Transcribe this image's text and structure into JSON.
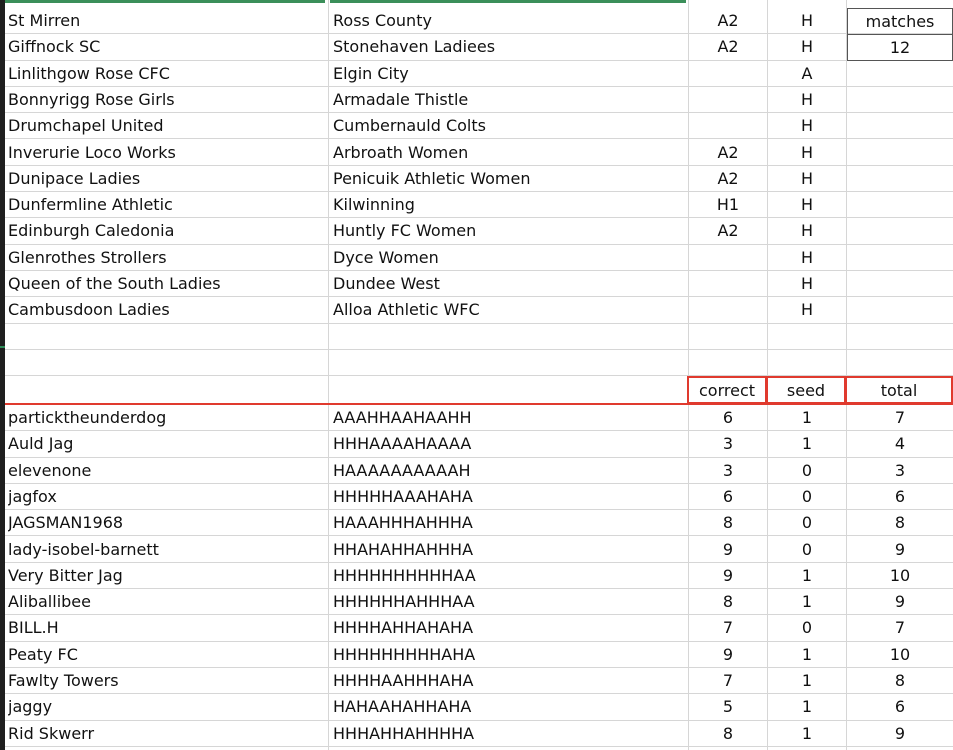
{
  "matches": [
    {
      "home": "St Mirren",
      "away": "Ross County",
      "code": "A2",
      "result": "H"
    },
    {
      "home": "Giffnock SC",
      "away": "Stonehaven Ladiees",
      "code": "A2",
      "result": "H"
    },
    {
      "home": "Linlithgow Rose CFC",
      "away": "Elgin City",
      "code": "",
      "result": "A"
    },
    {
      "home": "Bonnyrigg Rose Girls",
      "away": "Armadale Thistle",
      "code": "",
      "result": "H"
    },
    {
      "home": "Drumchapel United",
      "away": "Cumbernauld Colts",
      "code": "",
      "result": "H"
    },
    {
      "home": "Inverurie Loco Works",
      "away": "Arbroath Women",
      "code": "A2",
      "result": "H"
    },
    {
      "home": "Dunipace Ladies",
      "away": "Penicuik Athletic Women",
      "code": "A2",
      "result": "H"
    },
    {
      "home": "Dunfermline Athletic",
      "away": "Kilwinning",
      "code": "H1",
      "result": "H"
    },
    {
      "home": "Edinburgh Caledonia",
      "away": "Huntly FC Women",
      "code": "A2",
      "result": "H"
    },
    {
      "home": "Glenrothes Strollers",
      "away": "Dyce Women",
      "code": "",
      "result": "H"
    },
    {
      "home": "Queen of the South Ladies",
      "away": "Dundee West",
      "code": "",
      "result": "H"
    },
    {
      "home": "Cambusdoon Ladies",
      "away": "Alloa Athletic WFC",
      "code": "",
      "result": "H"
    }
  ],
  "matches_box": {
    "label": "matches",
    "count": "12"
  },
  "score_header": {
    "correct": "correct",
    "seed": "seed",
    "total": "total"
  },
  "players": [
    {
      "name": "particktheunderdog",
      "picks": "AAAHHAAHAAHH",
      "correct": "6",
      "seed": "1",
      "total": "7"
    },
    {
      "name": "Auld Jag",
      "picks": "HHHAAAAHAAAA",
      "correct": "3",
      "seed": "1",
      "total": "4"
    },
    {
      "name": "elevenone",
      "picks": "HAAAAAAAAAAH",
      "correct": "3",
      "seed": "0",
      "total": "3"
    },
    {
      "name": "jagfox",
      "picks": "HHHHHAAAHAHA",
      "correct": "6",
      "seed": "0",
      "total": "6"
    },
    {
      "name": "JAGSMAN1968",
      "picks": "HAAAHHHAHHHA",
      "correct": "8",
      "seed": "0",
      "total": "8"
    },
    {
      "name": "lady-isobel-barnett",
      "picks": "HHAHAHHAHHHA",
      "correct": "9",
      "seed": "0",
      "total": "9"
    },
    {
      "name": "Very Bitter Jag",
      "picks": "HHHHHHHHHHAA",
      "correct": "9",
      "seed": "1",
      "total": "10"
    },
    {
      "name": "Aliballibee",
      "picks": "HHHHHHAHHHAA",
      "correct": "8",
      "seed": "1",
      "total": "9"
    },
    {
      "name": "BILL.H",
      "picks": "HHHHAHHAHAHA",
      "correct": "7",
      "seed": "0",
      "total": "7"
    },
    {
      "name": "Peaty FC",
      "picks": "HHHHHHHHHAHA",
      "correct": "9",
      "seed": "1",
      "total": "10"
    },
    {
      "name": "Fawlty Towers",
      "picks": "HHHHAAHHHAHA",
      "correct": "7",
      "seed": "1",
      "total": "8"
    },
    {
      "name": "jaggy",
      "picks": "HAHAAHAHHAHA",
      "correct": "5",
      "seed": "1",
      "total": "6"
    },
    {
      "name": "Rid Skwerr",
      "picks": "HHHAHHAHHHHA",
      "correct": "8",
      "seed": "1",
      "total": "9"
    }
  ],
  "colors": {
    "accent_red": "#e03a2e",
    "gridline": "#d6d6d6",
    "gutter": "#1f1f1f",
    "selection_green": "#3b8f5a"
  }
}
